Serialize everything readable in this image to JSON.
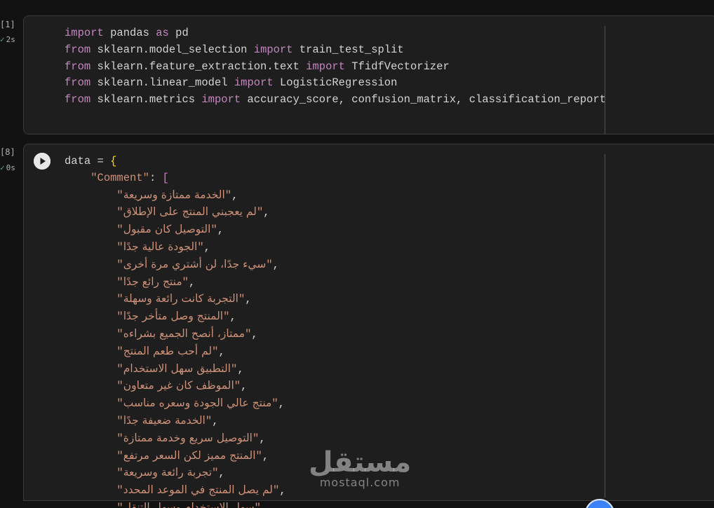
{
  "cell1": {
    "execution_count": "[1]",
    "exec_time": "2s",
    "lines": [
      {
        "kw1": "import",
        "t1": " pandas ",
        "kw2": "as",
        "t2": " pd"
      },
      {
        "kw1": "from",
        "t1": " sklearn.model_selection ",
        "kw2": "import",
        "t2": " train_test_split"
      },
      {
        "kw1": "from",
        "t1": " sklearn.feature_extraction.text ",
        "kw2": "import",
        "t2": " TfidfVectorizer"
      },
      {
        "kw1": "from",
        "t1": " sklearn.linear_model ",
        "kw2": "import",
        "t2": " LogisticRegression"
      },
      {
        "kw1": "from",
        "t1": " sklearn.metrics ",
        "kw2": "import",
        "t2": " accuracy_score, confusion_matrix, classification_report"
      }
    ]
  },
  "cell2": {
    "execution_count": "[8]",
    "exec_time": "0s",
    "var_line": "data = ",
    "open_brace": "{",
    "key": "\"Comment\"",
    "colon": ": ",
    "open_bracket": "[",
    "comments": [
      "الخدمة ممتازة وسريعة",
      "لم يعجبني المنتج على الإطلاق",
      "التوصيل كان مقبول",
      "الجودة عالية جدًا",
      "سيء جدًا، لن أشتري مرة أخرى",
      "منتج رائع جدًا",
      "التجربة كانت رائعة وسهلة",
      "المنتج وصل متأخر جدًا",
      "ممتاز، أنصح الجميع بشراءه",
      "لم أحب طعم المنتج",
      "التطبيق سهل الاستخدام",
      "الموظف كان غير متعاون",
      "منتج عالي الجودة وسعره مناسب",
      "الخدمة ضعيفة جدًا",
      "التوصيل سريع وخدمة ممتازة",
      "المنتج مميز لكن السعر مرتفع",
      "تجربة رائعة وسريعة",
      "لم يصل المنتج في الموعد المحدد",
      "سهل الاستخدام وسهل التنقل"
    ]
  },
  "watermark": {
    "arabic": "مستقل",
    "latin": "mostaql.com"
  },
  "colors": {
    "keyword": "#c586c0",
    "string": "#ce9178",
    "text": "#d4d4d4",
    "background": "#121212",
    "cell_background": "#1e1e1e",
    "success": "#5fb05f"
  }
}
